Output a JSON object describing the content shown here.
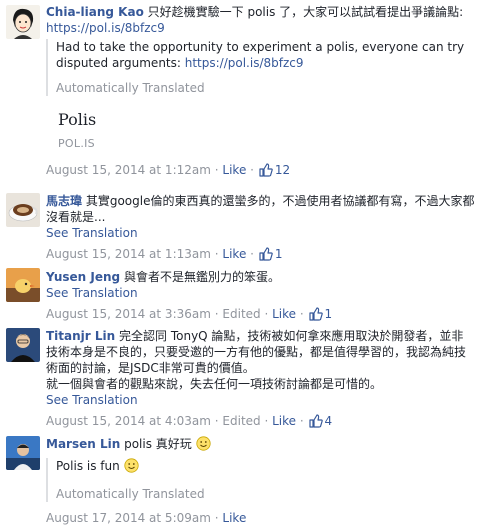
{
  "colors": {
    "link": "#365899",
    "meta": "#90949c",
    "text": "#1d2129",
    "rule": "#dddfe2"
  },
  "comments": [
    {
      "author": "Chia-liang Kao",
      "avatar_icon": "avatar-cartoon-person",
      "text": "只好趁機實驗一下 polis 了，大家可以試試看提出爭議論點:",
      "link": "https://pol.is/8bfzc9",
      "translation": "Had to take the opportunity to experiment a polis, everyone can try disputed arguments:",
      "translation_link": "https://pol.is/8bfzc9",
      "auto_label": "Automatically Translated",
      "preview_title": "Polis",
      "preview_domain": "POL.IS",
      "timestamp": "August 15, 2014 at 1:12am",
      "like_label": "Like",
      "likes": "12"
    },
    {
      "author": "馬志瑋",
      "avatar_icon": "avatar-coffee-cup",
      "text": "其實google倫的東西真的還蠻多的，不過使用者協議都有寫，不過大家都沒看就是...",
      "see_translation": "See Translation",
      "timestamp": "August 15, 2014 at 1:13am",
      "like_label": "Like",
      "likes": "1"
    },
    {
      "author": "Yusen Jeng",
      "avatar_icon": "avatar-bird",
      "text": "與會者不是無鑑別力的笨蛋。",
      "see_translation": "See Translation",
      "timestamp": "August 15, 2014 at 3:36am",
      "edited_label": "Edited",
      "like_label": "Like",
      "likes": "1"
    },
    {
      "author": "Titanjr Lin",
      "avatar_icon": "avatar-person",
      "text": "完全認同 TonyQ 論點，技術被如何拿來應用取決於開發者，並非技術本身是不良的，只要受邀的一方有他的優點，都是值得學習的，我認為純技術面的討論，是JSDC非常可貴的價值。",
      "text2": "就一個與會者的觀點來說，失去任何一項技術討論都是可惜的。",
      "see_translation": "See Translation",
      "timestamp": "August 15, 2014 at 4:03am",
      "edited_label": "Edited",
      "like_label": "Like",
      "likes": "4"
    },
    {
      "author": "Marsen Lin",
      "avatar_icon": "avatar-person-blue",
      "text": "polis 真好玩",
      "translation": "Polis is fun",
      "auto_label": "Automatically Translated",
      "timestamp": "August 17, 2014 at 5:09am",
      "like_label": "Like"
    }
  ]
}
